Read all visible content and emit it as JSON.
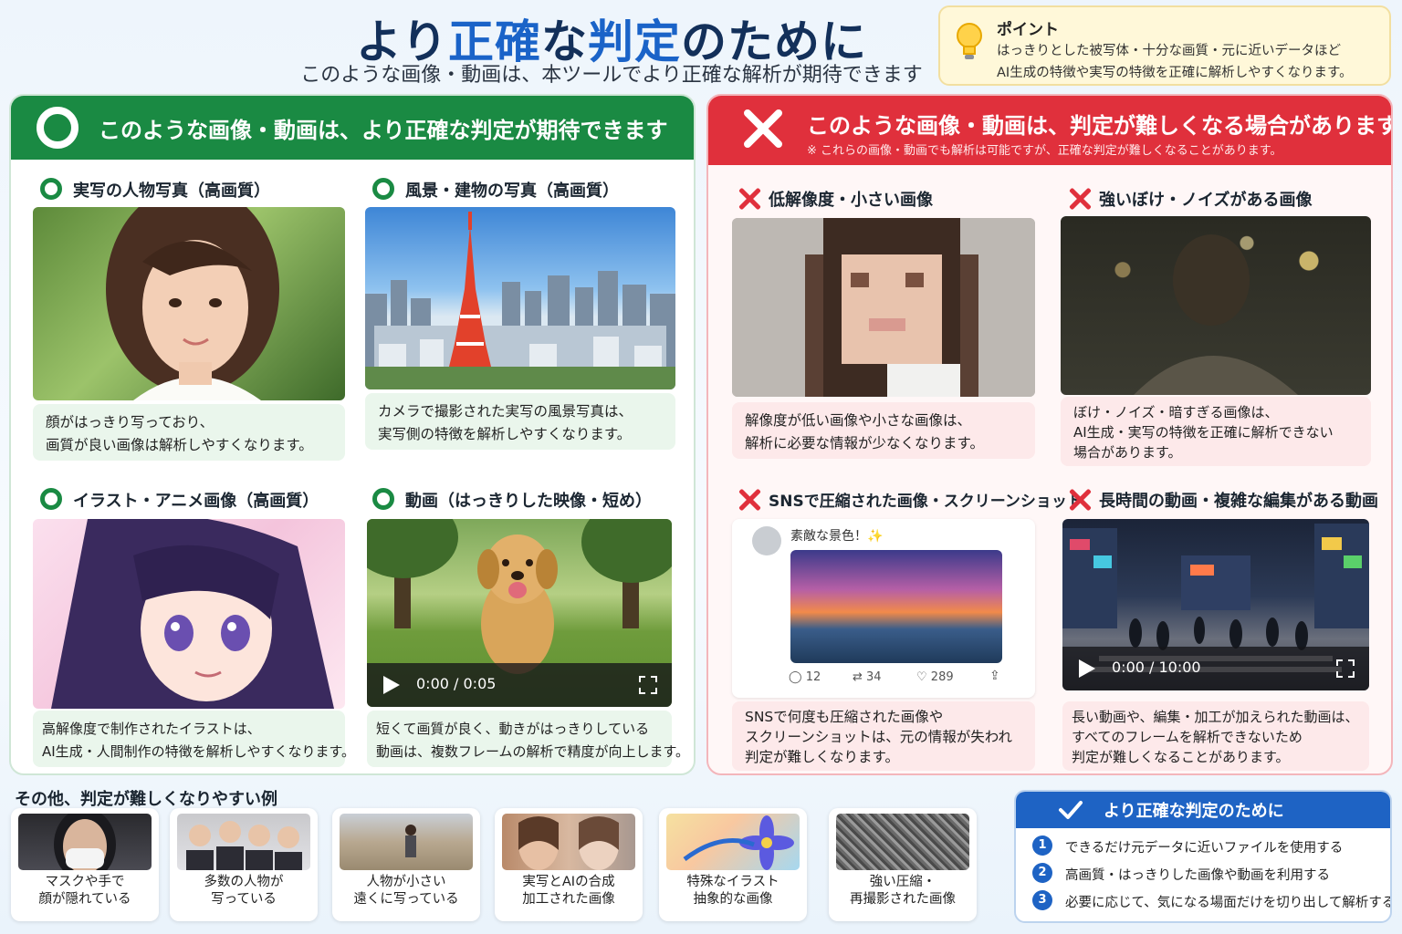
{
  "header": {
    "title_parts": [
      "より",
      "正確",
      "な",
      "判定",
      "のために"
    ],
    "subtitle": "このような画像・動画は、本ツールでより正確な解析が期待できます"
  },
  "point": {
    "title": "ポイント",
    "lines": [
      "はっきりとした被写体・十分な画質・元に近いデータほど",
      "AI生成の特徴や実写の特徴を正確に解析しやすくなります。"
    ]
  },
  "good": {
    "header": "このような画像・動画は、より正確な判定が期待できます",
    "cards": [
      {
        "title": "実写の人物写真（高画質）",
        "lines": [
          "顔がはっきり写っており、",
          "画質が良い画像は解析しやすくなります。"
        ]
      },
      {
        "title": "風景・建物の写真（高画質）",
        "lines": [
          "カメラで撮影された実写の風景写真は、",
          "実写側の特徴を解析しやすくなります。"
        ]
      },
      {
        "title": "イラスト・アニメ画像（高画質）",
        "lines": [
          "高解像度で制作されたイラストは、",
          "AI生成・人間制作の特徴を解析しやすくなります。"
        ]
      },
      {
        "title": "動画（はっきりした映像・短め）",
        "lines": [
          "短くて画質が良く、動きがはっきりしている",
          "動画は、複数フレームの解析で精度が向上します。"
        ],
        "video_time": "0:00 / 0:05"
      }
    ]
  },
  "bad": {
    "header": "このような画像・動画は、判定が難しくなる場合があります",
    "note": "※ これらの画像・動画でも解析は可能ですが、正確な判定が難しくなることがあります。",
    "cards": [
      {
        "title": "低解像度・小さい画像",
        "lines": [
          "解像度が低い画像や小さな画像は、",
          "解析に必要な情報が少なくなります。"
        ]
      },
      {
        "title": "強いぼけ・ノイズがある画像",
        "lines": [
          "ぼけ・ノイズ・暗すぎる画像は、",
          "AI生成・実写の特徴を正確に解析できない",
          "場合があります。"
        ]
      },
      {
        "title": "SNSで圧縮された画像・スクリーンショット",
        "lines": [
          "SNSで何度も圧縮された画像や",
          "スクリーンショットは、元の情報が失われ",
          "判定が難しくなります。"
        ]
      },
      {
        "title": "長時間の動画・複雑な編集がある動画",
        "lines": [
          "長い動画や、編集・加工が加えられた動画は、",
          "すべてのフレームを解析できないため",
          "判定が難しくなることがあります。"
        ],
        "video_time": "0:00 / 10:00"
      }
    ],
    "sns_post": {
      "text": "素敵な景色！✨",
      "replies": "12",
      "reposts": "34",
      "likes": "289"
    }
  },
  "others": {
    "title": "その他、判定が難しくなりやすい例",
    "items": [
      {
        "l1": "マスクや手で",
        "l2": "顔が隠れている"
      },
      {
        "l1": "多数の人物が",
        "l2": "写っている"
      },
      {
        "l1": "人物が小さい",
        "l2": "遠くに写っている"
      },
      {
        "l1": "実写とAIの合成",
        "l2": "加工された画像"
      },
      {
        "l1": "特殊なイラスト",
        "l2": "抽象的な画像"
      },
      {
        "l1": "強い圧縮・",
        "l2": "再撮影された画像"
      }
    ]
  },
  "tips": {
    "title": "より正確な判定のために",
    "items": [
      {
        "num": "1",
        "text": "できるだけ元データに近いファイルを使用する"
      },
      {
        "num": "2",
        "text": "高画質・はっきりした画像や動画を利用する"
      },
      {
        "num": "3",
        "text": "必要に応じて、気になる場面だけを切り出して解析する"
      }
    ]
  },
  "colors": {
    "good": "#1a8a43",
    "bad": "#e0303c",
    "accent": "#1e63c4",
    "title": "#13305a"
  }
}
